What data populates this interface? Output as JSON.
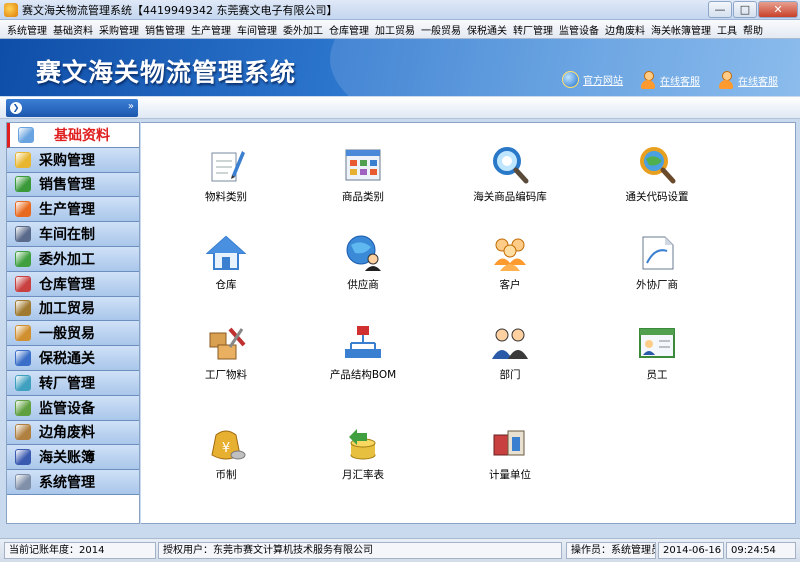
{
  "window": {
    "title": "赛文海关物流管理系统【4419949342 东莞赛文电子有限公司】",
    "minimize": "—",
    "maximize": "□",
    "close": "✕"
  },
  "menubar": [
    "系统管理",
    "基础资料",
    "采购管理",
    "销售管理",
    "生产管理",
    "车间管理",
    "委外加工",
    "仓库管理",
    "加工贸易",
    "一般贸易",
    "保税通关",
    "转厂管理",
    "监管设备",
    "边角废料",
    "海关帐簿管理",
    "工具",
    "帮助"
  ],
  "banner": {
    "title": "赛文海关物流管理系统",
    "links": [
      {
        "label": "官方网站",
        "icon": "globe-icon"
      },
      {
        "label": "在线客服",
        "icon": "person-icon"
      },
      {
        "label": "在线客服",
        "icon": "person-icon"
      }
    ]
  },
  "nav": {
    "toggle_glyph": "❯",
    "collapse_glyph": "»"
  },
  "sidebar": {
    "items": [
      {
        "label": "基础资料",
        "active": true,
        "color": "#6aa4e0"
      },
      {
        "label": "采购管理",
        "active": false,
        "color": "#e8b630"
      },
      {
        "label": "销售管理",
        "active": false,
        "color": "#3a9a3a"
      },
      {
        "label": "生产管理",
        "active": false,
        "color": "#e86a20"
      },
      {
        "label": "车间在制",
        "active": false,
        "color": "#5a6a8a"
      },
      {
        "label": "委外加工",
        "active": false,
        "color": "#40a040"
      },
      {
        "label": "仓库管理",
        "active": false,
        "color": "#c84040"
      },
      {
        "label": "加工贸易",
        "active": false,
        "color": "#a07a30"
      },
      {
        "label": "一般贸易",
        "active": false,
        "color": "#d09030"
      },
      {
        "label": "保税通关",
        "active": false,
        "color": "#3a6ec8"
      },
      {
        "label": "转厂管理",
        "active": false,
        "color": "#40a0c0"
      },
      {
        "label": "监管设备",
        "active": false,
        "color": "#60a040"
      },
      {
        "label": "边角废料",
        "active": false,
        "color": "#b08040"
      },
      {
        "label": "海关账簿",
        "active": false,
        "color": "#3a5ab0"
      },
      {
        "label": "系统管理",
        "active": false,
        "color": "#8090a8"
      }
    ]
  },
  "tiles": [
    {
      "label": "物料类别",
      "icon": "pen-paper-icon"
    },
    {
      "label": "商品类别",
      "icon": "window-grid-icon"
    },
    {
      "label": "海关商品编码库",
      "icon": "magnifier-icon"
    },
    {
      "label": "通关代码设置",
      "icon": "magnifier-globe-icon"
    },
    {
      "label": "仓库",
      "icon": "house-icon"
    },
    {
      "label": "供应商",
      "icon": "globe-person-icon"
    },
    {
      "label": "客户",
      "icon": "people-icon"
    },
    {
      "label": "外协厂商",
      "icon": "document-icon"
    },
    {
      "label": "工厂物料",
      "icon": "boxes-tools-icon"
    },
    {
      "label": "产品结构BOM",
      "icon": "hierarchy-icon"
    },
    {
      "label": "部门",
      "icon": "group-icon"
    },
    {
      "label": "员工",
      "icon": "id-card-icon"
    },
    {
      "label": "币制",
      "icon": "money-bag-icon"
    },
    {
      "label": "月汇率表",
      "icon": "coins-arrow-icon"
    },
    {
      "label": "计量单位",
      "icon": "measure-unit-icon"
    }
  ],
  "status": {
    "year": "当前记账年度：2014",
    "license": "授权用户：东莞市赛文计算机技术服务有限公司",
    "operator": "操作员：系统管理员",
    "date": "2014-06-16",
    "time": "09:24:54"
  },
  "colors": {
    "accent": "#1c57ad",
    "active_red": "#e02020",
    "banner_dark": "#0f4ea8"
  }
}
